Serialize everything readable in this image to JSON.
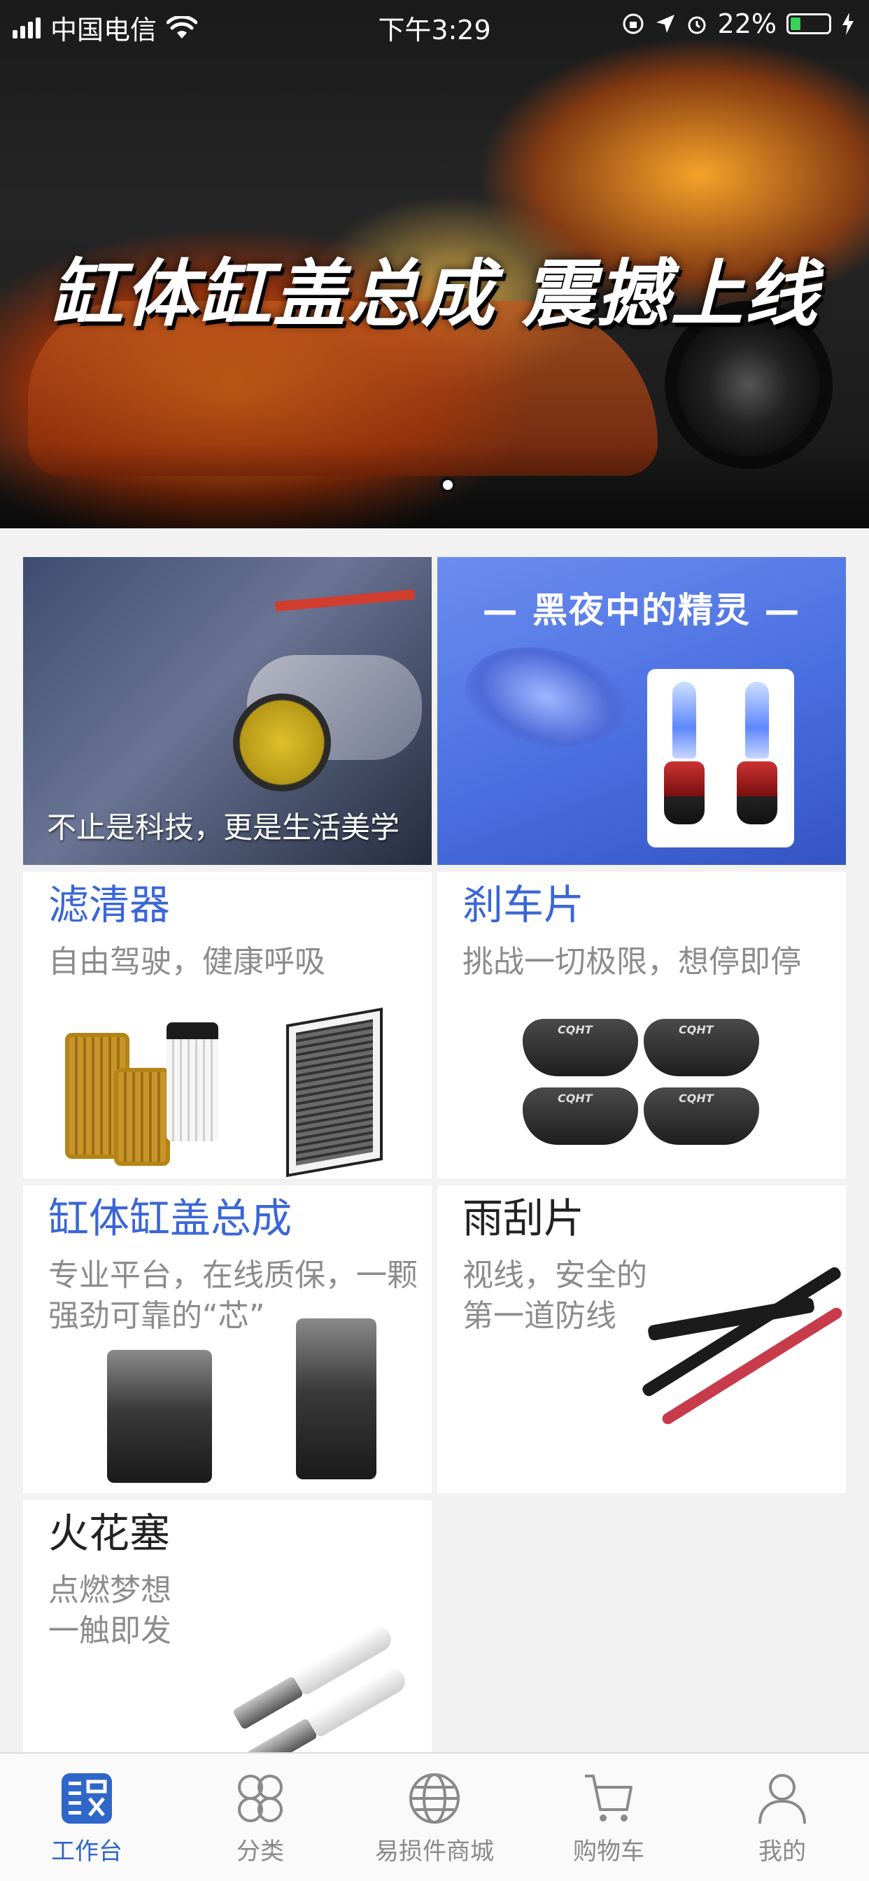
{
  "status_bar": {
    "carrier": "中国电信",
    "time": "下午3:29",
    "battery_percent": "22%"
  },
  "banner": {
    "headline": "缸体缸盖总成  震撼上线",
    "page_index": 1,
    "page_count": 1
  },
  "promos": {
    "left_caption": "不止是科技，更是生活美学",
    "right_title": "— 黑夜中的精灵 —"
  },
  "products": [
    {
      "title": "滤清器",
      "subtitle": "自由驾驶，健康呼吸",
      "title_color": "#3a66d6"
    },
    {
      "title": "刹车片",
      "subtitle": "挑战一切极限，想停即停",
      "title_color": "#3a66d6"
    },
    {
      "title": "缸体缸盖总成",
      "subtitle": "专业平台，在线质保，一颗强劲可靠的“芯”",
      "title_color": "#3a66d6"
    },
    {
      "title": "雨刮片",
      "subtitle_line1": "视线，安全的",
      "subtitle_line2": "第一道防线",
      "title_color": "#222222"
    },
    {
      "title": "火花塞",
      "subtitle_line1": "点燃梦想",
      "subtitle_line2": "一触即发",
      "title_color": "#222222"
    }
  ],
  "brake_pad_brand": "CQHT",
  "tab_bar": {
    "active_color": "#2f66c9",
    "inactive_color": "#8a8a8a",
    "tabs": [
      {
        "label": "工作台",
        "icon": "workbench-icon",
        "active": true
      },
      {
        "label": "分类",
        "icon": "category-icon",
        "active": false
      },
      {
        "label": "易损件商城",
        "icon": "globe-icon",
        "active": false
      },
      {
        "label": "购物车",
        "icon": "cart-icon",
        "active": false
      },
      {
        "label": "我的",
        "icon": "person-icon",
        "active": false
      }
    ]
  }
}
